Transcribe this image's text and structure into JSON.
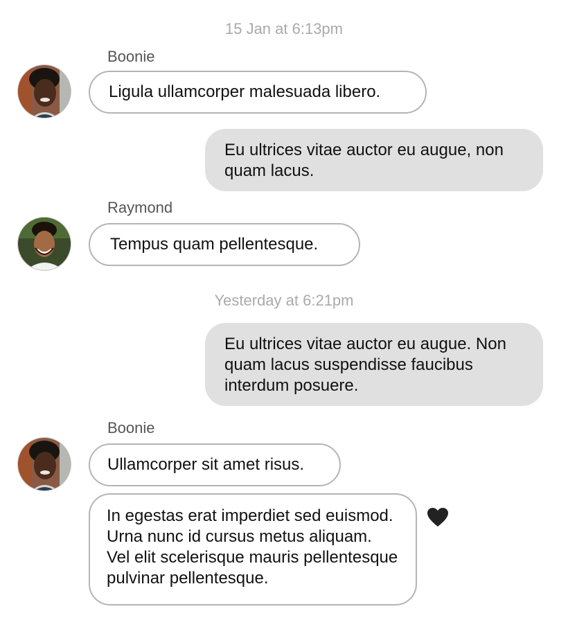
{
  "messages": {
    "timestamp_1": "15 Jan at 6:13pm",
    "timestamp_2": "Yesterday at 6:21pm",
    "group_1": {
      "sender": "Boonie",
      "avatar": "avatar-woman",
      "text": "Ligula ullamcorper malesuada libero."
    },
    "out_1": {
      "text": "Eu ultrices vitae auctor eu augue, non quam lacus."
    },
    "group_2": {
      "sender": "Raymond",
      "avatar": "avatar-man",
      "text": "Tempus quam pellentesque."
    },
    "out_2": {
      "text": "Eu ultrices vitae auctor eu augue. Non quam lacus suspendisse faucibus interdum posuere."
    },
    "group_3": {
      "sender": "Boonie",
      "avatar": "avatar-woman",
      "text_1": "Ullamcorper sit amet risus.",
      "text_2": "In egestas erat imperdiet sed euismod. Urna nunc id cursus metus aliquam. Vel elit scelerisque mauris pellentesque pulvinar pellentesque.",
      "reaction": "heart-icon"
    }
  },
  "colors": {
    "bubble_out": "#e0e0e0",
    "bubble_in_border": "#b4b4b4",
    "timestamp": "#aaaaaa",
    "sender": "#555555",
    "heart": "#222222"
  }
}
